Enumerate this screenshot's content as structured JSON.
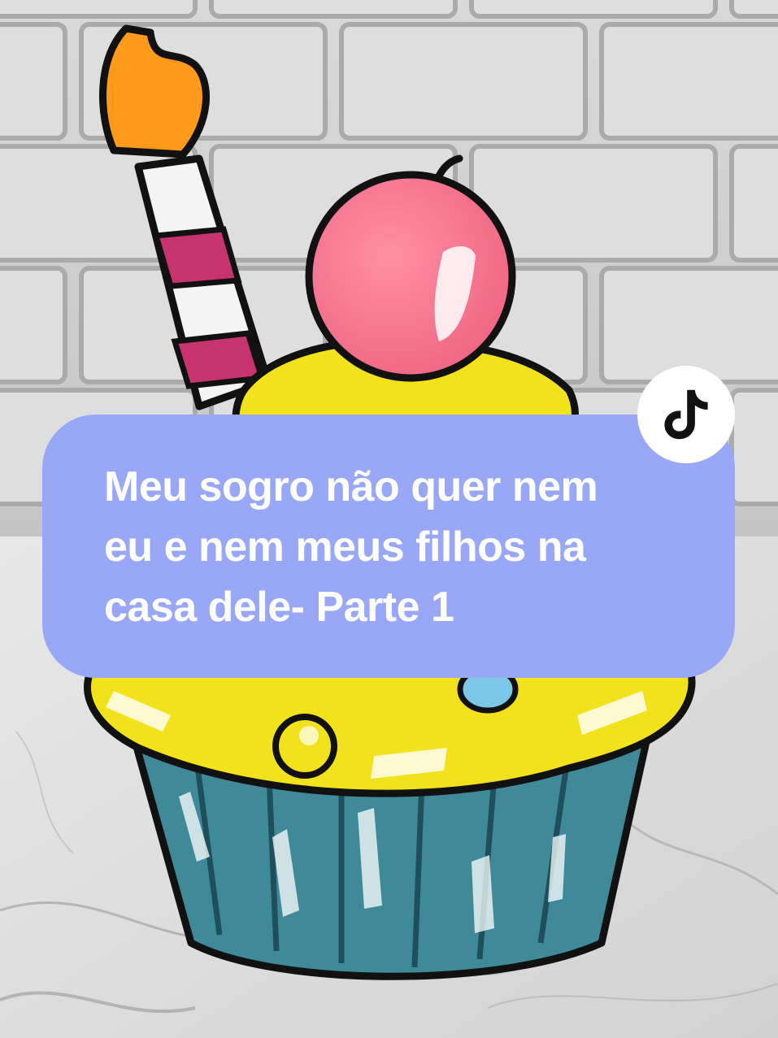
{
  "caption": {
    "lines": [
      "Meu sogro não quer nem",
      "eu e nem meus filhos na",
      "casa dele- Parte 1"
    ]
  },
  "badge": {
    "icon": "tiktok-logo-icon"
  },
  "scene": {
    "description_icons": [
      "candle-icon",
      "cherry-icon",
      "cupcake-icon"
    ],
    "colors": {
      "bubble": "#98a8f6",
      "frosting": "#f2e21b",
      "wrapper": "#3f8a98",
      "cherry": "#f47a92",
      "flame": "#ff9a1a"
    }
  }
}
